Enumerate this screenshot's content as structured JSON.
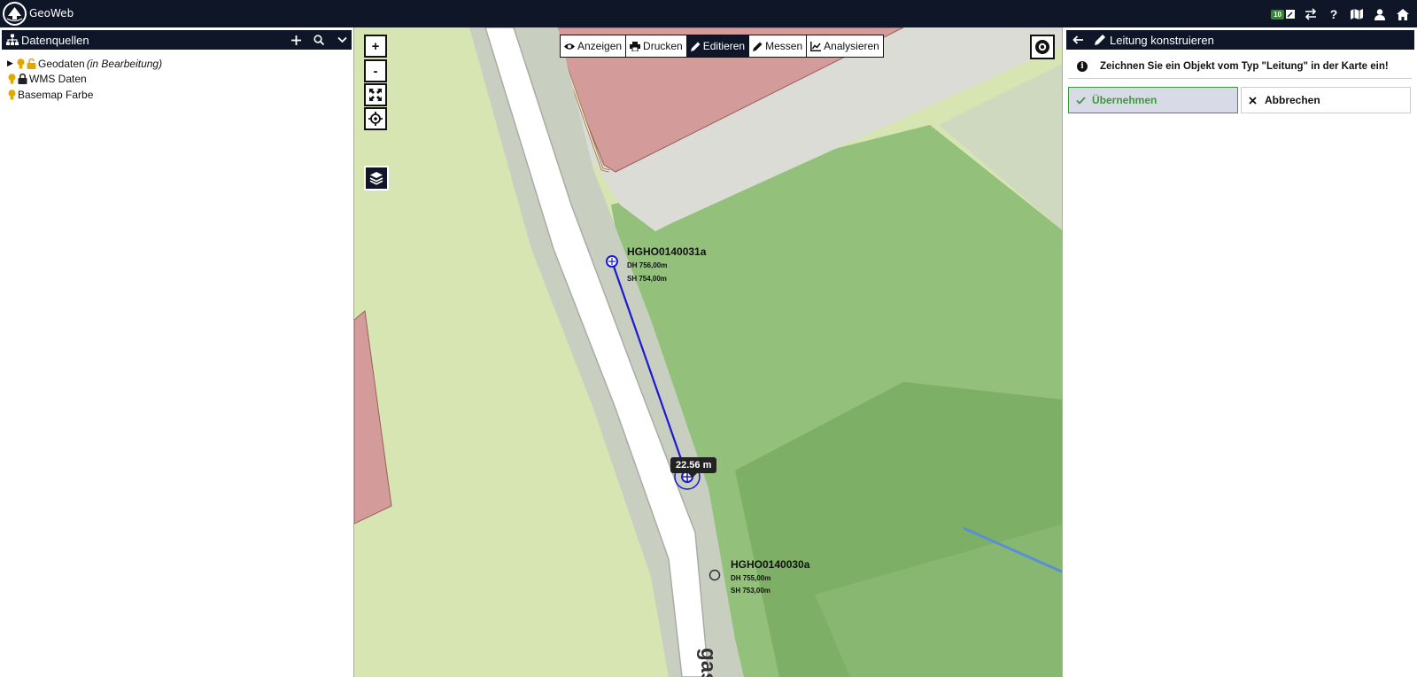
{
  "app": {
    "title": "GeoWeb",
    "badge_count": "10"
  },
  "left_panel": {
    "title": "Datenquellen",
    "tree": [
      {
        "label": "Geodaten",
        "suffix": "(in Bearbeitung)"
      },
      {
        "label": "WMS Daten"
      },
      {
        "label": "Basemap Farbe"
      }
    ]
  },
  "map": {
    "zoom_in": "+",
    "zoom_out": "-",
    "toolbar": [
      {
        "label": "Anzeigen",
        "icon": "eye-icon"
      },
      {
        "label": "Drucken",
        "icon": "printer-icon"
      },
      {
        "label": "Editieren",
        "icon": "pencil-icon",
        "active": true
      },
      {
        "label": "Messen",
        "icon": "ruler-icon"
      },
      {
        "label": "Analysieren",
        "icon": "chart-icon"
      }
    ],
    "points": [
      {
        "name": "HGHO0140031a",
        "dh": "DH 756,00m",
        "sh": "SH 754,00m"
      },
      {
        "name": "HGHO0140030a",
        "dh": "DH 755,00m",
        "sh": "SH 753,00m"
      }
    ],
    "measure": "22.56 m",
    "street_label": "gasse",
    "colors": {
      "line": "#1a1ad1",
      "building": "#d49b9b",
      "green": "#8fbf73"
    }
  },
  "right_panel": {
    "title": "Leitung konstruieren",
    "info": "Zeichnen Sie ein Objekt vom Typ \"Leitung\" in der Karte ein!",
    "ok_label": "Übernehmen",
    "cancel_label": "Abbrechen"
  }
}
